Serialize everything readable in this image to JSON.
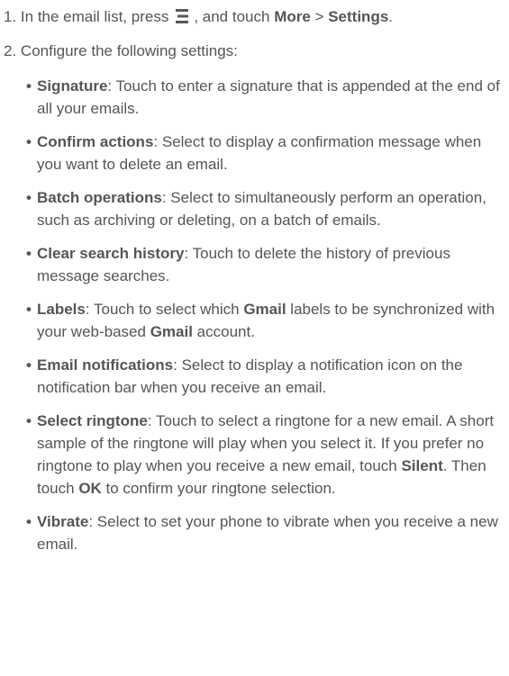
{
  "step1": {
    "number": "1.",
    "text_before_icon": "In the email list, press",
    "icon": "menu-icon",
    "text_after_icon": ", and touch",
    "more": "More",
    "separator": ">",
    "settings": "Settings",
    "end": "."
  },
  "step2": {
    "number": "2.",
    "text": "Configure the following settings:"
  },
  "items": [
    {
      "term": "Signature",
      "desc": ": Touch to enter a signature that is appended at the end of all your emails."
    },
    {
      "term": "Confirm actions",
      "desc": ": Select to display a confirmation message when you want to delete an email."
    },
    {
      "term": "Batch operations",
      "desc": ": Select to simultaneously perform an operation, such as archiving or deleting, on a batch of emails."
    },
    {
      "term": "Clear search history",
      "desc": ": Touch to delete the history of previous message searches."
    },
    {
      "term": "Labels",
      "desc_a": ": Touch to select which ",
      "bold_a": "Gmail",
      "desc_b": " labels to be synchronized with your web-based ",
      "bold_b": "Gmail",
      "desc_c": " account."
    },
    {
      "term": "Email notifications",
      "desc": ": Select to display a notification icon on the notification bar when you receive an email."
    },
    {
      "term": "Select ringtone",
      "desc_a": ": Touch to select a ringtone for a new email. A short sample of the ringtone will play when you select it. If you prefer no ringtone to play when you receive a new email, touch ",
      "bold_a": "Silent",
      "desc_b": ". Then touch ",
      "bold_b": "OK",
      "desc_c": " to confirm your ringtone selection."
    },
    {
      "term": "Vibrate",
      "desc": ": Select to set your phone to vibrate when you receive a new email."
    }
  ],
  "bullet": "•"
}
